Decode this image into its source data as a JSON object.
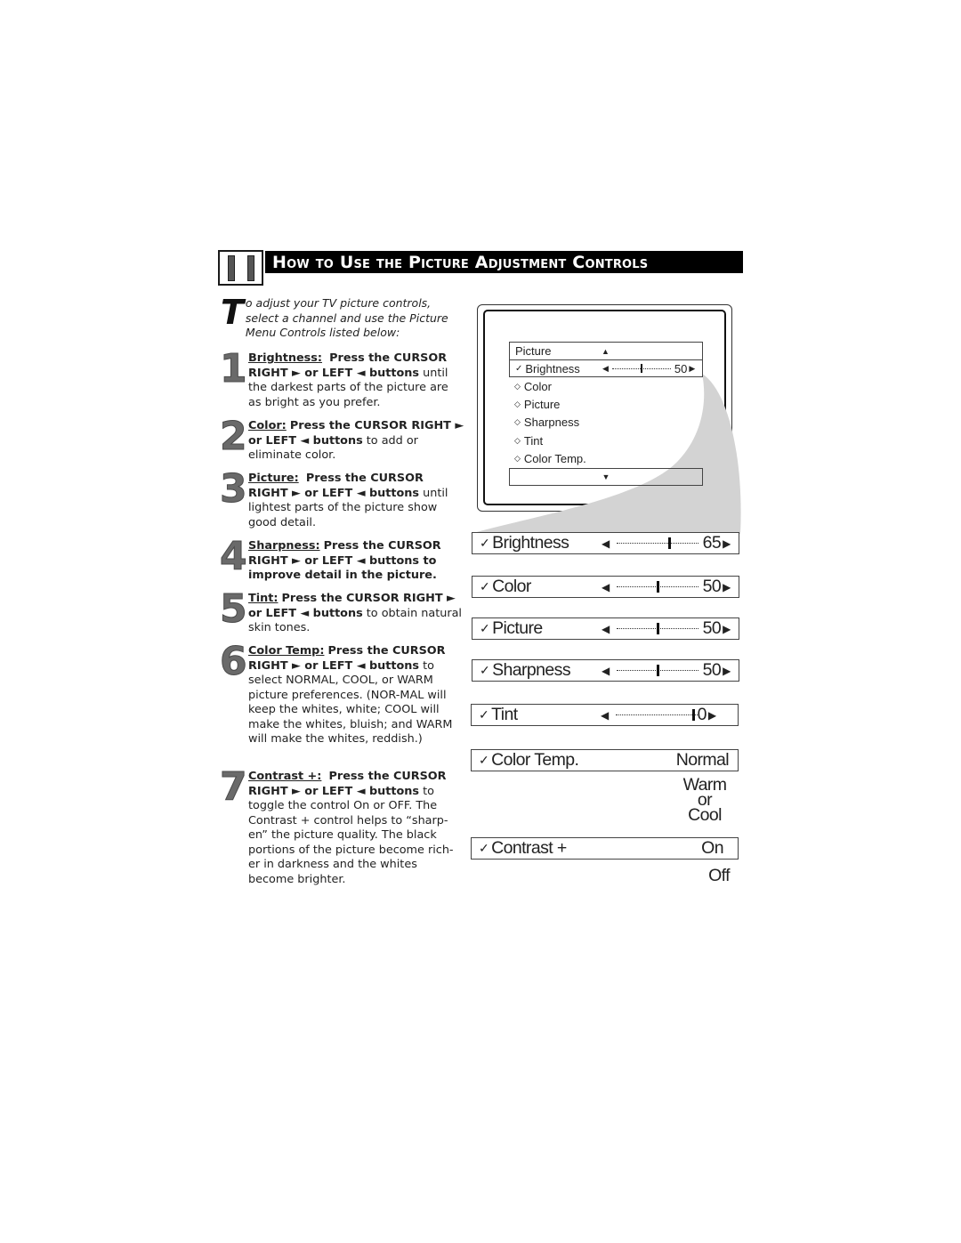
{
  "section": {
    "number": "11",
    "title": "How to Use the Picture Adjustment Controls"
  },
  "intro": {
    "dropcap": "T",
    "text": "o adjust your TV picture controls, select a channel and use the Picture Menu Controls listed below:"
  },
  "steps": [
    {
      "num": "1",
      "label": "Brightness:",
      "bold": "Press the CURSOR RIGHT ► or LEFT ◄ buttons",
      "text": "until the darkest parts of the picture are as bright as you prefer."
    },
    {
      "num": "2",
      "label": "Color:",
      "bold": "Press the CURSOR RIGHT ► or LEFT ◄ buttons",
      "text": "to add or eliminate color."
    },
    {
      "num": "3",
      "label": "Picture:",
      "bold": "Press the CURSOR RIGHT ► or LEFT ◄ buttons",
      "text": "until lightest parts of the picture show good detail."
    },
    {
      "num": "4",
      "label": "Sharpness:",
      "bold": "Press the CURSOR RIGHT ► or LEFT ◄ buttons to improve detail in the picture.",
      "text": ""
    },
    {
      "num": "5",
      "label": "Tint:",
      "bold": "Press the CURSOR RIGHT ► or LEFT ◄ buttons",
      "text": "to obtain natural skin tones."
    },
    {
      "num": "6",
      "label": "Color Temp:",
      "bold": "Press the CURSOR RIGHT ► or LEFT ◄ buttons",
      "text": "to select NORMAL, COOL, or WARM picture preferences. (NOR-MAL will keep the whites, white; COOL will make the whites, bluish; and WARM will make the whites, reddish.)"
    },
    {
      "num": "7",
      "label": "Contrast +:",
      "bold": "Press the CURSOR RIGHT ► or LEFT ◄ buttons",
      "text": "to toggle the control On or OFF. The Contrast + control helps to “sharp-en” the picture quality. The black portions of the picture become rich-er in darkness and the whites become brighter."
    }
  ],
  "tv_menu": {
    "header": "Picture",
    "up_icon": "▲",
    "down_icon": "▼",
    "selected": {
      "label": "Brightness",
      "value": "50",
      "level": 0.5
    },
    "items": [
      "Color",
      "Picture",
      "Sharpness",
      "Tint",
      "Color Temp."
    ]
  },
  "settings": [
    {
      "label": "Brightness",
      "value": "65",
      "level": 0.65
    },
    {
      "label": "Color",
      "value": "50",
      "level": 0.5
    },
    {
      "label": "Picture",
      "value": "50",
      "level": 0.5
    },
    {
      "label": "Sharpness",
      "value": "50",
      "level": 0.5
    },
    {
      "label": "Tint",
      "value": "0",
      "level": 0.95
    }
  ],
  "color_temp": {
    "label": "Color Temp.",
    "value": "Normal",
    "alt1": "Warm",
    "or": "or",
    "alt2": "Cool"
  },
  "contrast": {
    "label": "Contrast +",
    "value": "On",
    "alt": "Off"
  },
  "glyphs": {
    "check": "✓",
    "diamond": "◇",
    "left": "◀",
    "right": "▶"
  }
}
